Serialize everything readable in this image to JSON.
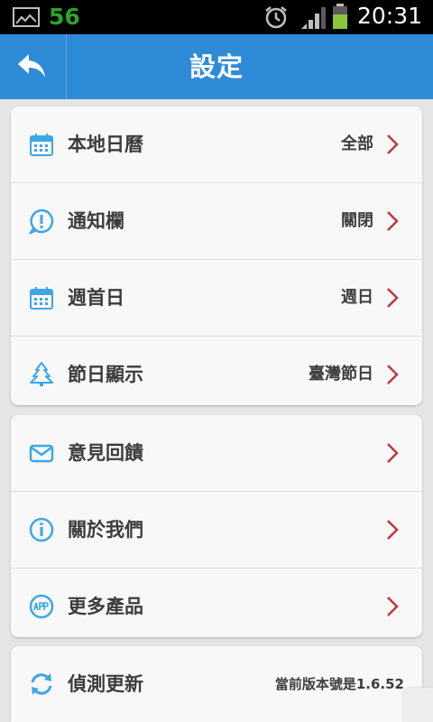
{
  "status_bar": {
    "notification_count": "56",
    "time": "20:31"
  },
  "header": {
    "title": "設定",
    "back_icon": "back-arrow-icon"
  },
  "colors": {
    "header_bg": "#2e8bd8",
    "icon_blue": "#3ea6e6",
    "chevron_red": "#c1363b"
  },
  "groups": [
    {
      "items": [
        {
          "label": "本地日曆",
          "value": "全部",
          "icon": "calendar-icon"
        },
        {
          "label": "通知欄",
          "value": "關閉",
          "icon": "notification-icon"
        },
        {
          "label": "週首日",
          "value": "週日",
          "icon": "calendar-icon"
        },
        {
          "label": "節日顯示",
          "value": "臺灣節日",
          "icon": "tree-icon"
        }
      ]
    },
    {
      "items": [
        {
          "label": "意見回饋",
          "icon": "mail-icon"
        },
        {
          "label": "關於我們",
          "icon": "info-icon"
        },
        {
          "label": "更多產品",
          "icon": "app-icon"
        }
      ]
    },
    {
      "items": [
        {
          "label": "偵測更新",
          "value": "當前版本號是1.6.52",
          "icon": "refresh-icon"
        }
      ]
    }
  ]
}
